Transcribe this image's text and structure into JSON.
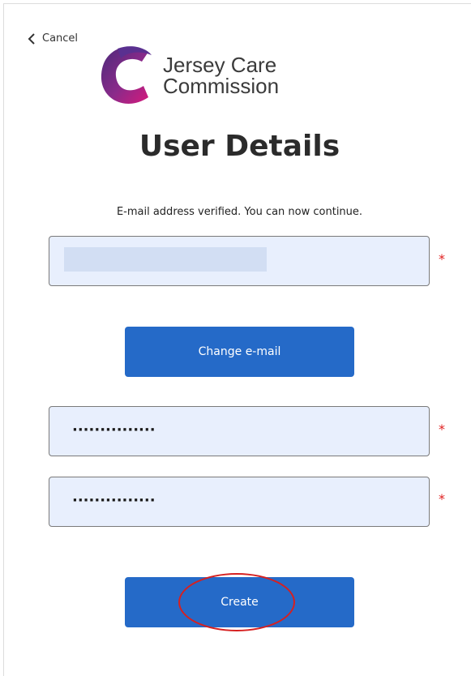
{
  "header": {
    "cancel_label": "Cancel",
    "cancel_icon": "chevron-left-icon"
  },
  "logo": {
    "line1": "Jersey Care",
    "line2": "Commission",
    "colors": {
      "purple": "#4b2a7a",
      "magenta": "#c2187e"
    }
  },
  "page": {
    "title": "User Details",
    "message": "E-mail address verified. You can now continue."
  },
  "form": {
    "email": {
      "value": "",
      "required_marker": "*"
    },
    "change_email_label": "Change e-mail",
    "password": {
      "masked_value": "···············",
      "required_marker": "*"
    },
    "confirm_password": {
      "masked_value": "···············",
      "required_marker": "*"
    },
    "create_label": "Create"
  },
  "colors": {
    "button_bg": "#256ac8",
    "field_bg": "#e8effd",
    "required": "#e02020",
    "annotation": "#d62020"
  }
}
